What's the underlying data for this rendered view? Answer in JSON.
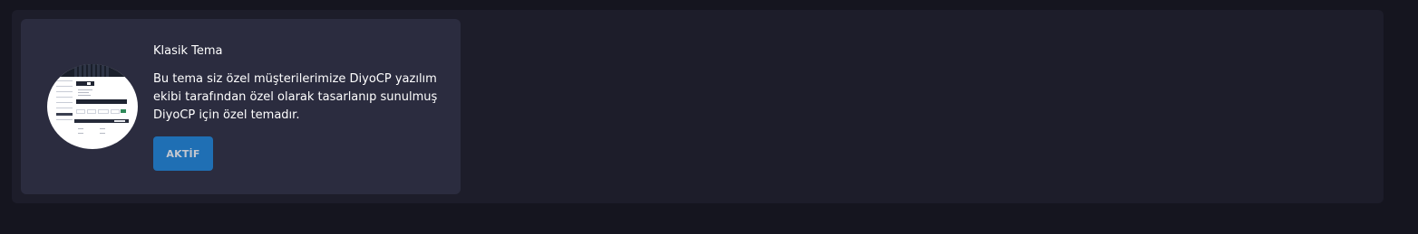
{
  "theme_card": {
    "title": "Klasik Tema",
    "description": "Bu tema siz özel müşterilerimize DiyoCP yazılım ekibi tarafından özel olarak tasarlanıp sunulmuş DiyoCP için özel temadır.",
    "status_button_label": "AKTİF",
    "thumbnail_icon": "theme-preview-thumbnail"
  },
  "colors": {
    "page_background": "#15151f",
    "panel_background": "#1d1d2a",
    "card_background": "#2b2c3f",
    "button_background": "#1f6fb4",
    "text": "#ffffff"
  }
}
